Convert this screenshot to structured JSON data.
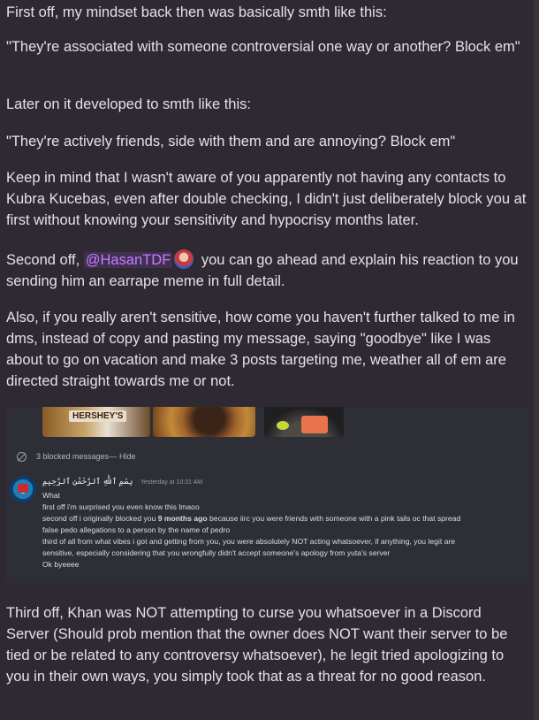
{
  "paragraphs": {
    "p1": "First off, my mindset back then was basically smth like this:",
    "p2": "\"They're associated with someone controversial one way or another? Block em\"",
    "p3": "Later on it developed to smth like this:",
    "p4": "\"They're actively friends, side with them and are annoying? Block em\"",
    "p5": "Keep in mind that I wasn't aware of you apparently not having any contacts to Kubra Kucebas, even after double checking, I didn't just deliberately block you at first without knowing your sensitivity and hypocrisy months later.",
    "p6_before": "Second off, ",
    "p6_mention": "@HasanTDF",
    "p6_after": " you can go ahead and explain his reaction to you sending him an earrape meme in full detail.",
    "p7": "Also, if you really aren't sensitive, how come you haven't further talked to me in dms, instead of copy and pasting my message, saying \"goodbye\" like I was about to go on vacation and make 3 posts targeting me, weather all of em are directed straight towards me or not.",
    "p8": "Third off, Khan was NOT attempting to curse you whatsoever in a Discord Server (Should prob mention that the owner does NOT want their server to be tied or be related to any controversy whatsoever), he legit tried apologizing to you in their own ways, you simply took that as a threat for no good reason."
  },
  "embed": {
    "thumb_brand": "HERSHEY'S",
    "blocked_label": "3 blocked messages",
    "blocked_sep": " — ",
    "hide_label": "Hide",
    "message": {
      "author": "بِسْمِ ٱللَّٰهِ ٱلرَّحْمَٰنِ ٱلرَّحِيمِ",
      "timestamp": "Yesterday at 10:31 AM",
      "lines": [
        "What",
        "first off i'm surprised you even know this lmaoo",
        "second off i originally blocked you ",
        "false pedo allegations to a person by the name of pedro",
        "third of all from what vibes i got and getting from you, you were absolutely NOT acting whatsoever, if anything, you legit are",
        "sensitive, especially considering that you wrongfully didn't accept someone's apology from yuta's server",
        "Ok byeeee"
      ],
      "line3_bold": "9 months ago",
      "line3_rest": " because iirc you were friends with someone with a pink tails oc that spread"
    }
  }
}
